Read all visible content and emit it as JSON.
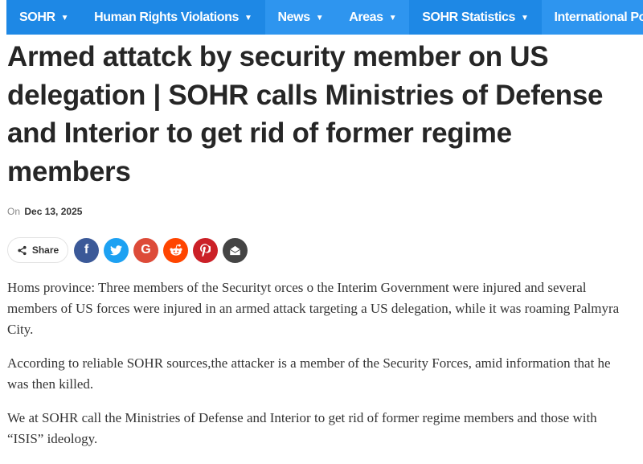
{
  "nav": {
    "items": [
      {
        "label": "SOHR",
        "chevron": "chevron-down-icon"
      },
      {
        "label": "Human Rights Violations",
        "chevron": "chevron-down-icon"
      },
      {
        "label": "News",
        "chevron": "chevron-down-icon"
      },
      {
        "label": "Areas",
        "chevron": "chevron-down-icon"
      },
      {
        "label": "SOHR Statistics",
        "chevron": "chevron-down-icon"
      },
      {
        "label": "International Powers",
        "chevron": ""
      }
    ],
    "bar_color": "#1e88e5",
    "alt_color": "#2e95ef"
  },
  "article": {
    "title": "Armed attatck by security member on US delegation | SOHR calls Ministries of Defense and Interior to get rid of former regime members",
    "meta_prefix": "On",
    "date": "Dec 13, 2025",
    "paragraphs": [
      "Homs province: Three members of the Securityt orces o the Interim Government were injured and several members of US forces were injured in an armed attack targeting a US delegation, while it was roaming Palmyra City.",
      "According to reliable SOHR sources,the attacker is a member of the Security Forces, amid information that he was then killed.",
      "We at SOHR call the Ministries of Defense and Interior to get rid of former regime members and those with “ISIS” ideology."
    ]
  },
  "share": {
    "label": "Share",
    "icon": "share-icon",
    "buttons": [
      {
        "name": "facebook",
        "glyph": "f",
        "color": "#3b5998"
      },
      {
        "name": "twitter",
        "glyph": "",
        "color": "#1da1f2"
      },
      {
        "name": "google",
        "glyph": "G",
        "color": "#dd4b39"
      },
      {
        "name": "reddit",
        "glyph": "",
        "color": "#ff4500"
      },
      {
        "name": "pinterest",
        "glyph": "",
        "color": "#cb2027"
      },
      {
        "name": "email",
        "glyph": "",
        "color": "#444444"
      }
    ]
  }
}
